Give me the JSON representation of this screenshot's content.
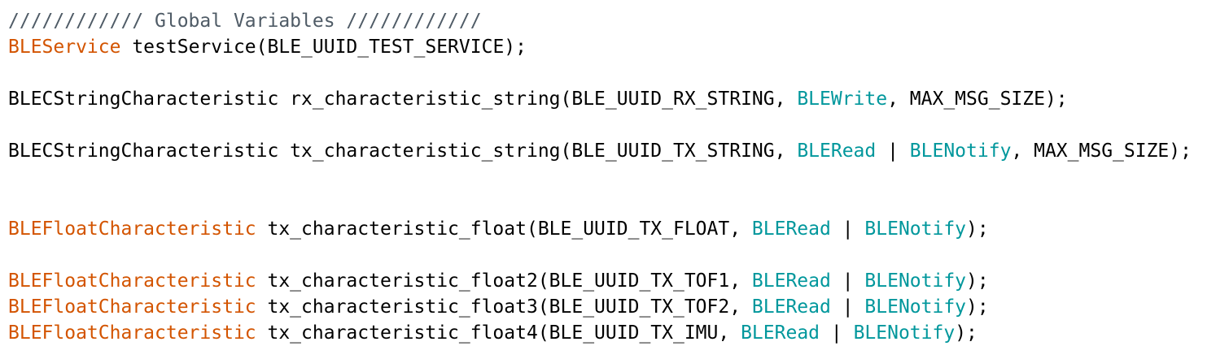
{
  "editor": {
    "lines": [
      [
        {
          "text": "//////////// Global Variables ////////////",
          "kind": "comment"
        }
      ],
      [
        {
          "text": "BLEService",
          "kind": "type"
        },
        {
          "text": " testService(BLE_UUID_TEST_SERVICE);",
          "kind": "plain"
        }
      ],
      [],
      [
        {
          "text": "BLECStringCharacteristic rx_characteristic_string(BLE_UUID_RX_STRING, ",
          "kind": "plain"
        },
        {
          "text": "BLEWrite",
          "kind": "const"
        },
        {
          "text": ", MAX_MSG_SIZE);",
          "kind": "plain"
        }
      ],
      [],
      [
        {
          "text": "BLECStringCharacteristic tx_characteristic_string(BLE_UUID_TX_STRING, ",
          "kind": "plain"
        },
        {
          "text": "BLERead",
          "kind": "const"
        },
        {
          "text": " | ",
          "kind": "plain"
        },
        {
          "text": "BLENotify",
          "kind": "const"
        },
        {
          "text": ", MAX_MSG_SIZE);",
          "kind": "plain"
        }
      ],
      [],
      [],
      [
        {
          "text": "BLEFloatCharacteristic",
          "kind": "type"
        },
        {
          "text": " tx_characteristic_float(BLE_UUID_TX_FLOAT, ",
          "kind": "plain"
        },
        {
          "text": "BLERead",
          "kind": "const"
        },
        {
          "text": " | ",
          "kind": "plain"
        },
        {
          "text": "BLENotify",
          "kind": "const"
        },
        {
          "text": ");",
          "kind": "plain"
        }
      ],
      [],
      [
        {
          "text": "BLEFloatCharacteristic",
          "kind": "type"
        },
        {
          "text": " tx_characteristic_float2(BLE_UUID_TX_TOF1, ",
          "kind": "plain"
        },
        {
          "text": "BLERead",
          "kind": "const"
        },
        {
          "text": " | ",
          "kind": "plain"
        },
        {
          "text": "BLENotify",
          "kind": "const"
        },
        {
          "text": ");",
          "kind": "plain"
        }
      ],
      [
        {
          "text": "BLEFloatCharacteristic",
          "kind": "type"
        },
        {
          "text": " tx_characteristic_float3(BLE_UUID_TX_TOF2, ",
          "kind": "plain"
        },
        {
          "text": "BLERead",
          "kind": "const"
        },
        {
          "text": " | ",
          "kind": "plain"
        },
        {
          "text": "BLENotify",
          "kind": "const"
        },
        {
          "text": ");",
          "kind": "plain"
        }
      ],
      [
        {
          "text": "BLEFloatCharacteristic",
          "kind": "type"
        },
        {
          "text": " tx_characteristic_float4(BLE_UUID_TX_IMU, ",
          "kind": "plain"
        },
        {
          "text": "BLERead",
          "kind": "const"
        },
        {
          "text": " | ",
          "kind": "plain"
        },
        {
          "text": "BLENotify",
          "kind": "const"
        },
        {
          "text": ");",
          "kind": "plain"
        }
      ]
    ]
  }
}
